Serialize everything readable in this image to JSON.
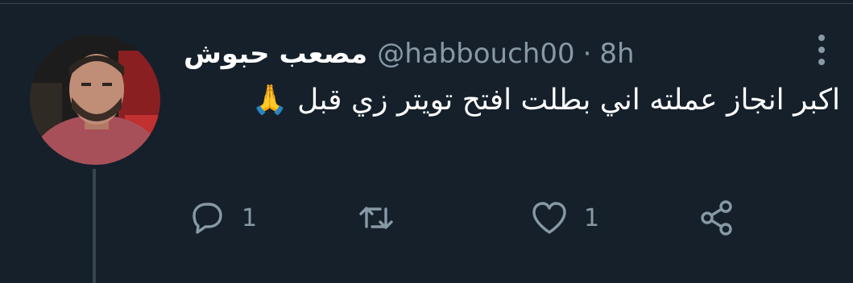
{
  "tweet": {
    "display_name": "مصعب حبوش",
    "handle": "@habbouch00",
    "separator": "·",
    "time": "8h",
    "text": "اكبر انجاز عملته اني بطلت افتح تويتر زي قبل 🙏",
    "reply_count": "1",
    "retweet_count": "",
    "like_count": "1"
  },
  "icons": {
    "more": "more-vertical-icon",
    "reply": "reply-icon",
    "retweet": "retweet-icon",
    "like": "heart-icon",
    "share": "share-icon"
  },
  "colors": {
    "background": "#15202b",
    "text": "#ffffff",
    "secondary": "#8899a6",
    "divider": "#38444d"
  }
}
